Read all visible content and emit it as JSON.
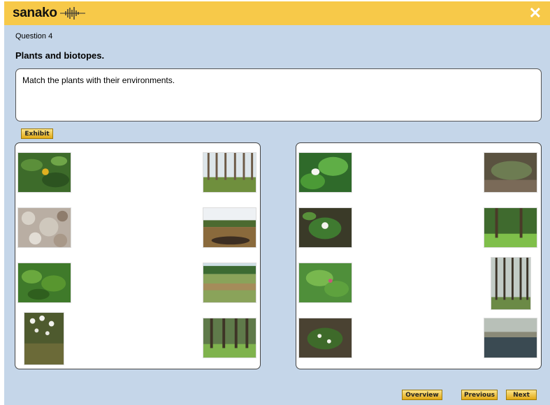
{
  "app": {
    "logo_text": "sanako"
  },
  "question": {
    "number_label": "Question 4",
    "title": "Plants and biotopes.",
    "instruction": "Match the plants with their environments."
  },
  "buttons": {
    "exhibit": "Exhibit",
    "overview": "Overview",
    "previous": "Previous",
    "next": "Next"
  },
  "icons": {
    "close": "close-icon"
  },
  "colors": {
    "title_bar": "#f7c949",
    "background": "#c5d6e9",
    "button": "#e9b52a"
  }
}
